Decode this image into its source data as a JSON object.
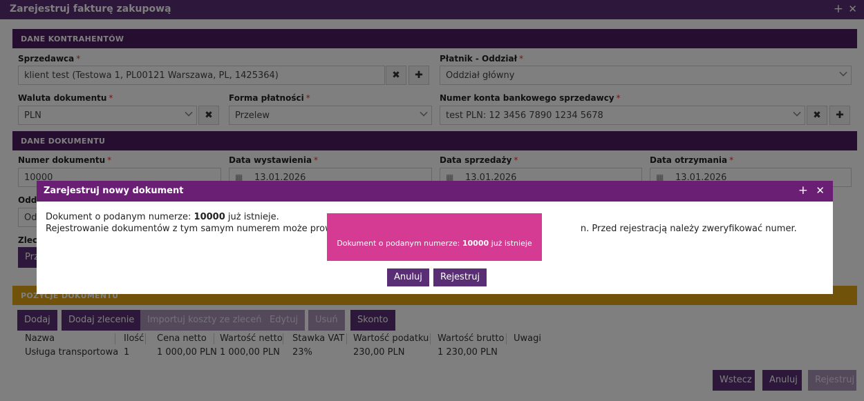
{
  "window": {
    "title": "Zarejestruj fakturę zakupową",
    "plus": "+",
    "close": "✕"
  },
  "sections": {
    "contractors": "DANE KONTRAHENTÓW",
    "document": "DANE DOKUMENTU",
    "positions": "POZYCJE DOKUMENTU"
  },
  "required_mark": "*",
  "contractors": {
    "seller_label": "Sprzedawca",
    "seller_value": "klient test (Testowa 1, PL00121 Warszawa, PL, 1425364)",
    "payer_label": "Płatnik - Oddział",
    "payer_value": "Oddział główny",
    "currency_label": "Waluta dokumentu",
    "currency_value": "PLN",
    "payment_label": "Forma płatności",
    "payment_value": "Przelew",
    "account_label": "Numer konta bankowego sprzedawcy",
    "account_value": "test PLN: 12 3456 7890 1234 5678",
    "clear_symbol": "✖",
    "add_symbol": "✚"
  },
  "document": {
    "number_label": "Numer dokumentu",
    "number_value": "10000",
    "issue_label": "Data wystawienia",
    "issue_value": "13.01.2026",
    "sale_label": "Data sprzedaży",
    "sale_value": "13.01.2026",
    "receive_label": "Data otrzymania",
    "receive_value": "13.01.2026",
    "branch_label_partial": "Oddz",
    "branch_value_partial": "Od",
    "order_label_partial": "Zlece",
    "order_button_partial": "Prz",
    "calendar_glyph": "▦"
  },
  "positions": {
    "buttons": {
      "add": "Dodaj",
      "add_order": "Dodaj zlecenie",
      "import": "Importuj koszty ze zleceń",
      "edit": "Edytuj",
      "delete": "Usuń",
      "discount": "Skonto"
    },
    "columns": [
      "Nazwa",
      "Ilość",
      "Cena netto",
      "Wartość netto",
      "Stawka VAT",
      "Wartość podatku",
      "Wartość brutto",
      "Uwagi"
    ],
    "rows": [
      [
        "Usługa transportowa",
        "1",
        "1 000,00 PLN",
        "1 000,00 PLN",
        "23%",
        "230,00 PLN",
        "1 230,00 PLN",
        ""
      ]
    ]
  },
  "footer": {
    "back": "Wstecz",
    "cancel": "Anuluj",
    "register": "Rejestruj"
  },
  "modal": {
    "title": "Zarejestruj nowy dokument",
    "plus": "+",
    "close": "✕",
    "line1_prefix": "Dokument o podanym numerze: ",
    "line1_number": "10000",
    "line1_suffix": " już istnieje.",
    "line2_start": "Rejestrowanie dokumentów z tym samym numerem może prowadzić d",
    "line2_end": "n. Przed rejestracją należy zweryfikować numer.",
    "cancel": "Anuluj",
    "register": "Rejestruj"
  },
  "toast": {
    "prefix": "Dokument o podanym numerze: ",
    "number": "10000",
    "suffix": " już istnieje"
  }
}
